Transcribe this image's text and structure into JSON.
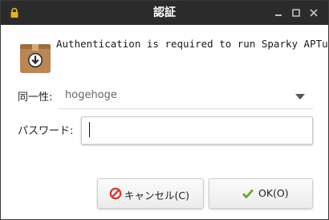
{
  "window": {
    "title": "認証"
  },
  "dialog": {
    "message": "Authentication is required to run Sparky APTus",
    "identity_label": "同一性:",
    "identity_value": "hogehoge",
    "password_label": "パスワード:",
    "password_value": ""
  },
  "buttons": {
    "cancel_label": "キャンセル(C)",
    "ok_label": "OK(O)"
  },
  "colors": {
    "titlebar": "#2b2b2b",
    "lock": "#e6b21f",
    "cancel_icon": "#d9302b",
    "ok_icon": "#6aa52c"
  },
  "icons": {
    "titlebar": "lock-icon",
    "app": "package-install-icon",
    "cancel": "cancel-icon",
    "ok": "check-icon"
  }
}
